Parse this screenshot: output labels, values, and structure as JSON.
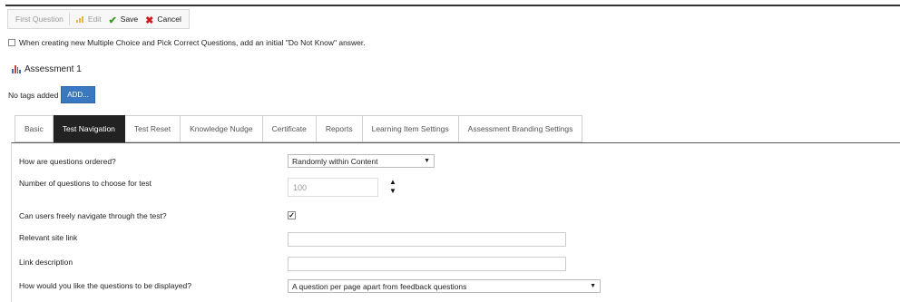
{
  "toolbar": {
    "first_question": "First Question",
    "edit_label": "Edit",
    "save_label": "Save",
    "cancel_label": "Cancel"
  },
  "option": {
    "do_not_know_label": "When creating new Multiple Choice and Pick Correct Questions, add an initial \"Do Not Know\" answer.",
    "checked": false
  },
  "assessment": {
    "title": "Assessment 1"
  },
  "tags": {
    "empty_text": "No tags added",
    "add_label": "ADD..."
  },
  "tabs": [
    {
      "label": "Basic",
      "active": false
    },
    {
      "label": "Test Navigation",
      "active": true
    },
    {
      "label": "Test Reset",
      "active": false
    },
    {
      "label": "Knowledge Nudge",
      "active": false
    },
    {
      "label": "Certificate",
      "active": false
    },
    {
      "label": "Reports",
      "active": false
    },
    {
      "label": "Learning Item Settings",
      "active": false
    },
    {
      "label": "Assessment Branding Settings",
      "active": false
    }
  ],
  "form": {
    "order_label": "How are questions ordered?",
    "order_value": "Randomly within Content",
    "count_label": "Number of questions to choose for test",
    "count_value": "100",
    "navigate_label": "Can users freely navigate through the test?",
    "navigate_checked": true,
    "site_link_label": "Relevant site link",
    "site_link_value": "",
    "link_desc_label": "Link description",
    "link_desc_value": "",
    "display_label": "How would you like the questions to be displayed?",
    "display_value": "A question per page apart from feedback questions"
  },
  "colors": {
    "accent_blue": "#3a78c0",
    "active_tab": "#222222",
    "save_green": "#3a9a2a",
    "cancel_red": "#d01c1c"
  }
}
